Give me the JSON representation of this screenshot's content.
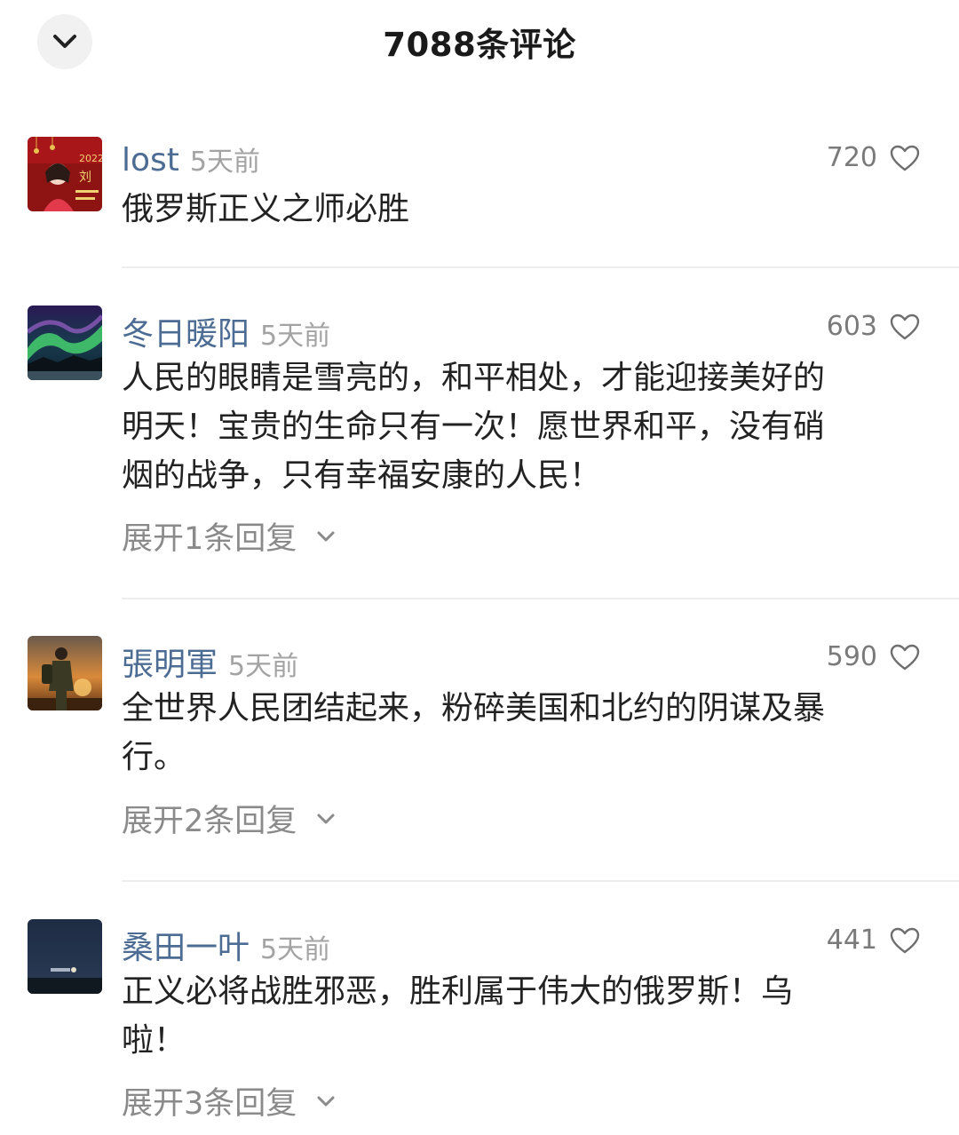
{
  "header": {
    "title": "7088条评论"
  },
  "comments": [
    {
      "username": "lost",
      "time": "5天前",
      "likes": "720",
      "text": "俄罗斯正义之师必胜",
      "expand": ""
    },
    {
      "username": "冬日暖阳",
      "time": "5天前",
      "likes": "603",
      "text": "人民的眼睛是雪亮的，和平相处，才能迎接美好的\n明天！宝贵的生命只有一次！愿世界和平，没有硝\n烟的战争，只有幸福安康的人民！",
      "expand": "展开1条回复"
    },
    {
      "username": "張明軍",
      "time": "5天前",
      "likes": "590",
      "text": "全世界人民团结起来，粉碎美国和北约的阴谋及暴\n行。",
      "expand": "展开2条回复"
    },
    {
      "username": "桑田一叶",
      "time": "5天前",
      "likes": "441",
      "text": "正义必将战胜邪恶，胜利属于伟大的俄罗斯！乌\n啦！",
      "expand": "展开3条回复"
    }
  ],
  "icons": {
    "collapse": "chevron-down-icon",
    "like": "heart-outline-icon",
    "expand": "chevron-down-icon"
  },
  "colors": {
    "username": "#4d6c94",
    "meta": "#a3a3a3",
    "text": "#222222"
  }
}
